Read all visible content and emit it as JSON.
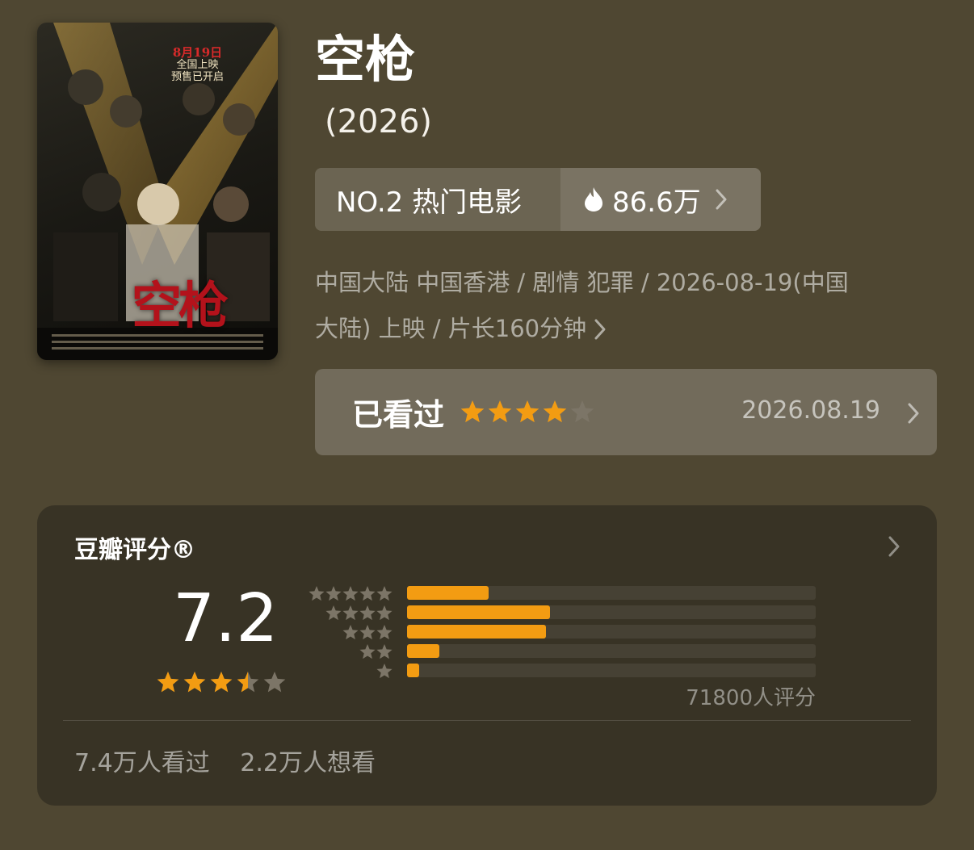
{
  "poster": {
    "date_line1": "8月19日",
    "date_line2": "全国上映",
    "date_line3": "预售已开启",
    "title_art": "空枪"
  },
  "movie": {
    "title": "空枪",
    "year": "(2026)"
  },
  "rank": {
    "label": "NO.2 热门电影",
    "heat": "86.6万",
    "heat_icon": "flame-icon"
  },
  "meta": {
    "line1": "中国大陆 中国香港 / 剧情 犯罪 / 2026-08-19(中国",
    "line2": "大陆) 上映 / 片长160分钟"
  },
  "watched": {
    "label": "已看过",
    "user_stars": 4,
    "date": "2026.08.19"
  },
  "douban": {
    "heading": "豆瓣评分®",
    "score": "7.2",
    "score_stars": 3.5,
    "distribution": [
      {
        "stars": 5,
        "fraction": 0.2
      },
      {
        "stars": 4,
        "fraction": 0.35
      },
      {
        "stars": 3,
        "fraction": 0.34
      },
      {
        "stars": 2,
        "fraction": 0.08
      },
      {
        "stars": 1,
        "fraction": 0.03
      }
    ],
    "raters": "71800人评分",
    "watched_count": "7.4万人看过",
    "want_count": "2.2万人想看"
  },
  "colors": {
    "background": "#4f4732",
    "accent_orange": "#f39c12",
    "star_gray": "#7c7567"
  }
}
